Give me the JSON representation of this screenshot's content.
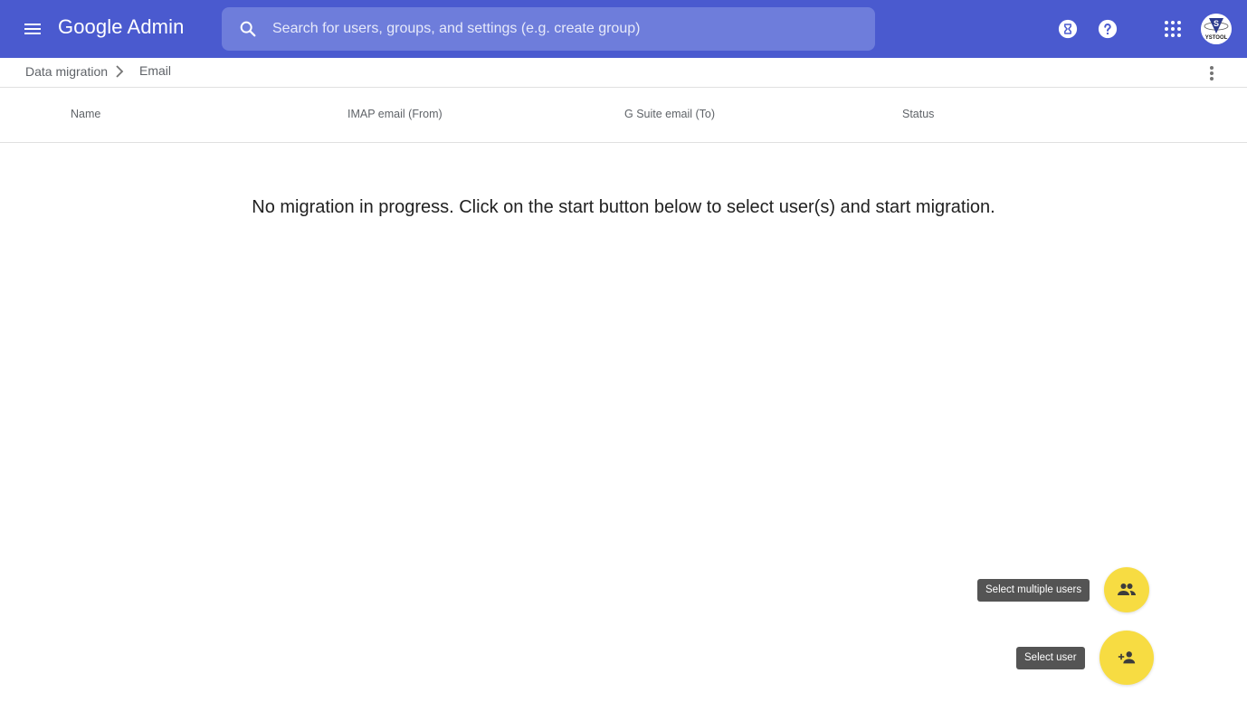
{
  "header": {
    "app_title": "Google Admin",
    "search_placeholder": "Search for users, groups, and settings (e.g. create group)",
    "search_value": "",
    "icons": [
      "menu-icon",
      "search-icon",
      "hourglass-icon",
      "help-icon",
      "apps-grid-icon",
      "avatar"
    ],
    "avatar_label": "YSTOOL",
    "brand_color": "#4a5acf"
  },
  "breadcrumb": {
    "items": [
      "Data migration",
      "Email"
    ]
  },
  "table": {
    "columns": [
      "Name",
      "IMAP email (From)",
      "G Suite email (To)",
      "Status"
    ],
    "rows": []
  },
  "main": {
    "empty_message": "No migration in progress. Click on the start button below to select user(s) and start migration."
  },
  "actions": {
    "multiple_users_tooltip": "Select multiple users",
    "single_user_tooltip": "Select user",
    "fab_color": "#f7dc42"
  }
}
